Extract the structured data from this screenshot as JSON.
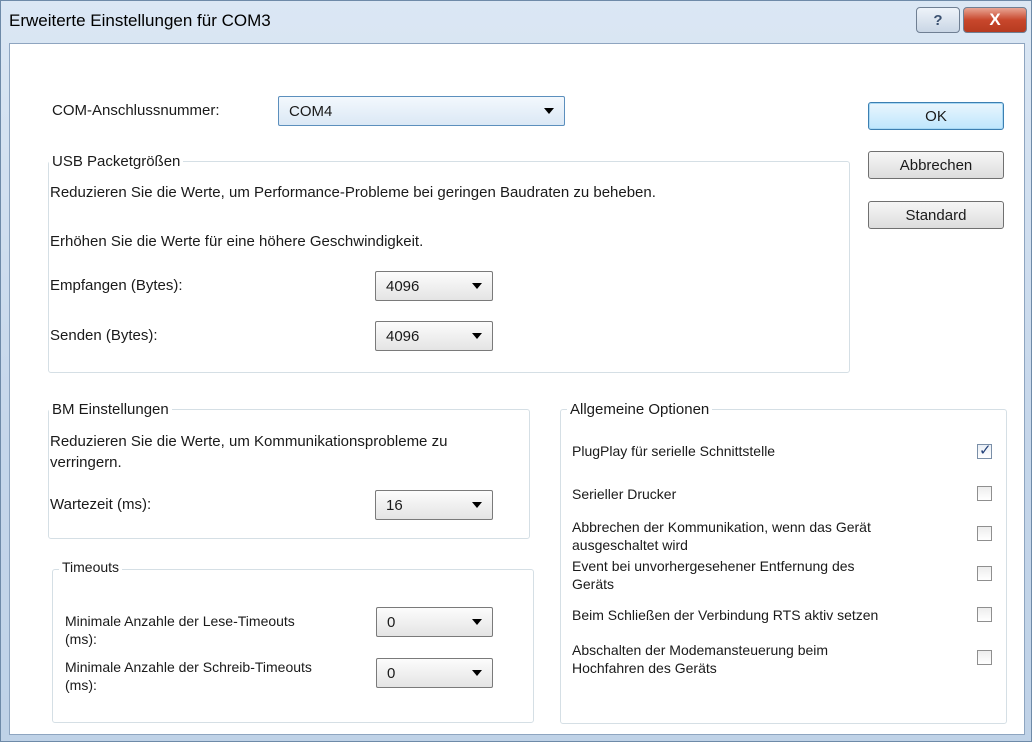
{
  "window": {
    "title": "Erweiterte Einstellungen für COM3",
    "help_glyph": "?",
    "close_glyph": "X"
  },
  "com_port": {
    "label": "COM-Anschlussnummer:",
    "value": "COM4"
  },
  "buttons": {
    "ok": "OK",
    "cancel": "Abbrechen",
    "default": "Standard"
  },
  "usb": {
    "title": "USB Packetgrößen",
    "hint_reduce": "Reduzieren Sie die Werte, um Performance-Probleme bei geringen Baudraten zu beheben.",
    "hint_increase": "Erhöhen Sie die Werte für eine höhere Geschwindigkeit.",
    "receive_label": "Empfangen (Bytes):",
    "receive_value": "4096",
    "send_label": "Senden (Bytes):",
    "send_value": "4096"
  },
  "bm": {
    "title": "BM Einstellungen",
    "hint_line1": "Reduzieren Sie die Werte, um Kommunikationsprobleme zu",
    "hint_line2": "verringern.",
    "latency_label": "Wartezeit (ms):",
    "latency_value": "16"
  },
  "timeouts": {
    "title": "Timeouts",
    "read_label_line1": "Minimale Anzahle der Lese-Timeouts",
    "read_label_line2": "(ms):",
    "read_value": "0",
    "write_label_line1": "Minimale Anzahle der Schreib-Timeouts",
    "write_label_line2": "(ms):",
    "write_value": "0"
  },
  "options": {
    "title": "Allgemeine Optionen",
    "items": [
      {
        "line1": "PlugPlay für serielle Schnittstelle",
        "line2": "",
        "checked": true
      },
      {
        "line1": "Serieller Drucker",
        "line2": "",
        "checked": false
      },
      {
        "line1": "Abbrechen der Kommunikation, wenn das Gerät",
        "line2": "ausgeschaltet wird",
        "checked": false
      },
      {
        "line1": "Event bei unvorhergesehener Entfernung des",
        "line2": "Geräts",
        "checked": false
      },
      {
        "line1": "Beim Schließen der Verbindung RTS aktiv setzen",
        "line2": "",
        "checked": false
      },
      {
        "line1": "Abschalten der Modemansteuerung beim",
        "line2": "Hochfahren des Geräts",
        "checked": false
      }
    ]
  }
}
